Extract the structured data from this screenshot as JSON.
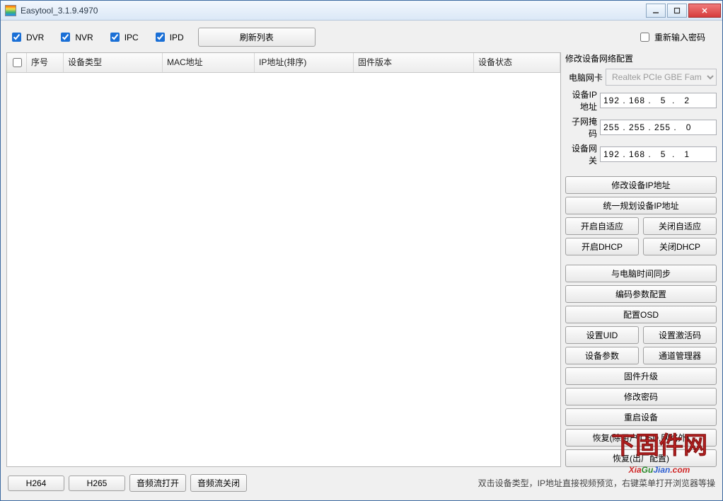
{
  "window": {
    "title": "Easytool_3.1.9.4970"
  },
  "filters": {
    "dvr": "DVR",
    "nvr": "NVR",
    "ipc": "IPC",
    "ipd": "IPD",
    "refresh": "刷新列表",
    "reenter_password": "重新输入密码"
  },
  "columns": {
    "seq": "序号",
    "type": "设备类型",
    "mac": "MAC地址",
    "ip": "IP地址(排序)",
    "fw": "固件版本",
    "status": "设备状态"
  },
  "netcfg": {
    "title": "修改设备网络配置",
    "nic_label": "电脑网卡",
    "nic_value": "Realtek PCIe GBE Fam",
    "ip_label": "设备IP地址",
    "ip_value": "192 . 168 .   5  .   2",
    "mask_label": "子网掩码",
    "mask_value": "255 . 255 . 255 .   0",
    "gw_label": "设备网关",
    "gw_value": "192 . 168 .   5  .   1"
  },
  "buttons": {
    "modify_ip": "修改设备IP地址",
    "plan_ip": "统一规划设备IP地址",
    "adapt_on": "开启自适应",
    "adapt_off": "关闭自适应",
    "dhcp_on": "开启DHCP",
    "dhcp_off": "关闭DHCP",
    "time_sync": "与电脑时间同步",
    "enc_cfg": "编码参数配置",
    "osd_cfg": "配置OSD",
    "set_uid": "设置UID",
    "set_act": "设置激活码",
    "dev_param": "设备参数",
    "chan_mgr": "通道管理器",
    "fw_up": "固件升级",
    "chg_pwd": "修改密码",
    "reboot": "重启设备",
    "restore_partial": "恢复(除用户,OSD,网络外)",
    "restore_full": "恢复(出厂配置)"
  },
  "bottom": {
    "h264": "H264",
    "h265": "H265",
    "audio_on": "音频流打开",
    "audio_off": "音频流关闭",
    "hint": "双击设备类型，IP地址直接视频预览，右键菜单打开浏览器等操"
  },
  "watermark": {
    "cn": "下固件网",
    "en_parts": [
      "Xia",
      "Gu",
      "Jian",
      ".com"
    ]
  }
}
